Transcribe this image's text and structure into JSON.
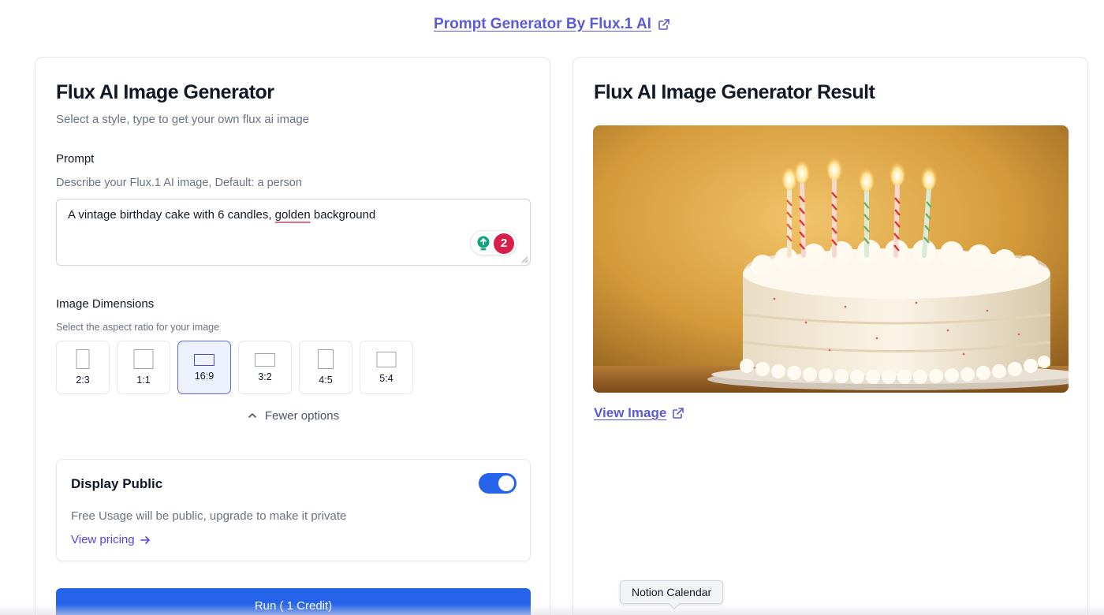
{
  "header": {
    "link_label": "Prompt Generator By Flux.1 AI"
  },
  "generator": {
    "title": "Flux AI Image Generator",
    "subtitle": "Select a style, type to get your own flux ai image",
    "prompt": {
      "label": "Prompt",
      "help": "Describe your Flux.1 AI image, Default: a person",
      "value_before": "A vintage birthday cake with 6 candles, ",
      "value_flagged": "golden",
      "value_after": " background",
      "grammar_issue_count": "2"
    },
    "dimensions": {
      "label": "Image Dimensions",
      "help": "Select the aspect ratio for your image",
      "options": [
        {
          "label": "2:3",
          "selected": false
        },
        {
          "label": "1:1",
          "selected": false
        },
        {
          "label": "16:9",
          "selected": true
        },
        {
          "label": "3:2",
          "selected": false
        },
        {
          "label": "4:5",
          "selected": false
        },
        {
          "label": "5:4",
          "selected": false
        }
      ],
      "toggle_label": "Fewer options"
    },
    "public": {
      "title": "Display Public",
      "enabled": true,
      "description": "Free Usage will be public, upgrade to make it private",
      "pricing_link": "View pricing"
    },
    "run_button": "Run ( 1 Credit)"
  },
  "result": {
    "title": "Flux AI Image Generator Result",
    "view_image_label": "View Image"
  },
  "tooltip": {
    "text": "Notion Calendar"
  },
  "colors": {
    "accent": "#2563eb",
    "link": "#5b5bd6",
    "selected_border": "#6366f1",
    "grammar_badge": "#d6204a"
  }
}
